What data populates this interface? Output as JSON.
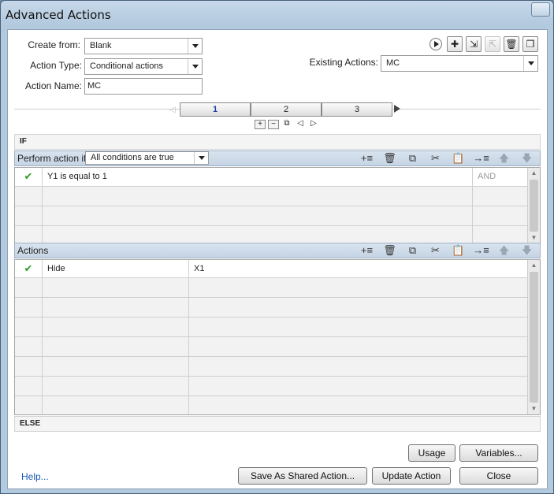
{
  "window": {
    "title": "Advanced Actions"
  },
  "form": {
    "create_from_label": "Create from:",
    "create_from_value": "Blank",
    "action_type_label": "Action Type:",
    "action_type_value": "Conditional actions",
    "action_name_label": "Action Name:",
    "action_name_value": "MC",
    "existing_actions_label": "Existing Actions:",
    "existing_actions_value": "MC"
  },
  "tabs": [
    {
      "label": "1",
      "active": true
    },
    {
      "label": "2",
      "active": false
    },
    {
      "label": "3",
      "active": false
    }
  ],
  "if_section": {
    "header": "IF",
    "perform_label": "Perform action if:",
    "perform_value": "All conditions are true",
    "conditions": [
      {
        "checked": true,
        "text": "Y1   is equal to     1",
        "op": "AND"
      }
    ],
    "empty_rows": 3
  },
  "actions_section": {
    "header": "Actions",
    "rows": [
      {
        "checked": true,
        "action": "Hide",
        "target": "X1"
      }
    ],
    "empty_rows": 7
  },
  "else_section": {
    "header": "ELSE"
  },
  "buttons": {
    "usage": "Usage",
    "variables": "Variables...",
    "save_shared": "Save As Shared Action...",
    "update": "Update Action",
    "close": "Close",
    "help": "Help..."
  },
  "icons": {
    "toolbar": [
      "add-row-icon",
      "delete-icon",
      "copy-icon",
      "cut-icon",
      "paste-icon",
      "insert-icon",
      "move-up-icon",
      "move-down-icon"
    ],
    "top": [
      "preview-play-icon",
      "new-action-icon",
      "import-icon",
      "export-icon",
      "trash-icon",
      "duplicate-icon"
    ]
  }
}
